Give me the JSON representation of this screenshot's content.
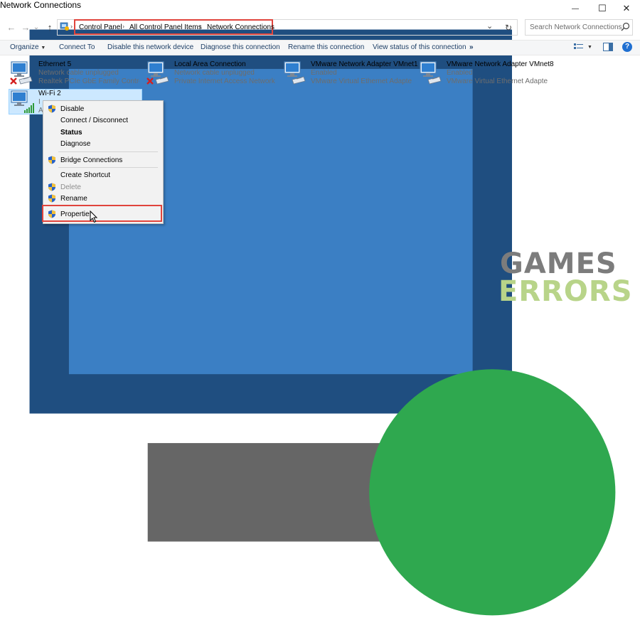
{
  "window": {
    "title": "Network Connections",
    "minimize_glyph": "—",
    "maximize_glyph": "☐",
    "close_glyph": "✕"
  },
  "nav": {
    "back_glyph": "←",
    "forward_glyph": "→",
    "recent_glyph": "⌄",
    "up_glyph": "↑"
  },
  "breadcrumb": {
    "items": [
      "Control Panel",
      "All Control Panel Items",
      "Network Connections"
    ],
    "separator": "›",
    "lead_separator": "›"
  },
  "address": {
    "dropdown_glyph": "⌄",
    "refresh_glyph": "↻"
  },
  "search": {
    "placeholder": "Search Network Connections"
  },
  "commands": {
    "organize": "Organize",
    "organize_arrow": "▼",
    "connect_to": "Connect To",
    "disable_device": "Disable this network device",
    "diagnose": "Diagnose this connection",
    "rename": "Rename this connection",
    "view_status": "View status of this connection",
    "more": "»",
    "view_arrow": "▼",
    "help": "?"
  },
  "adapters": [
    {
      "name": "Ethernet 5",
      "status": "Network cable unplugged",
      "device": "Realtek PCIe GbE Family Controll...",
      "error": true
    },
    {
      "name": "Local Area Connection",
      "status": "Network cable unplugged",
      "device": "Private Internet Access Network A...",
      "error": true
    },
    {
      "name": "VMware Network Adapter VMnet1",
      "status": "Enabled",
      "device": "VMware Virtual Ethernet Adapter ...",
      "error": false
    },
    {
      "name": "VMware Network Adapter VMnet8",
      "status": "Enabled",
      "device": "VMware Virtual Ethernet Adapter ...",
      "error": false
    },
    {
      "name": "Wi-Fi 2",
      "status": "I",
      "device": "A",
      "selected": true
    }
  ],
  "context_menu": {
    "items": [
      {
        "label": "Disable",
        "shield": true
      },
      {
        "label": "Connect / Disconnect",
        "shield": false
      },
      {
        "label": "Status",
        "shield": false,
        "bold": true
      },
      {
        "label": "Diagnose",
        "shield": false
      },
      {
        "label": "Bridge Connections",
        "shield": true
      },
      {
        "label": "Create Shortcut",
        "shield": false
      },
      {
        "label": "Delete",
        "shield": true,
        "disabled": true
      },
      {
        "label": "Rename",
        "shield": true
      },
      {
        "label": "Properties",
        "shield": true,
        "highlighted": true
      }
    ]
  },
  "watermark": {
    "line1": "GAMES",
    "line2": "ERRORS"
  },
  "colors": {
    "accent_red": "#e0443c",
    "selection": "#cce8ff",
    "command_text": "#1e3f66",
    "watermark_gray": "#7c7c7c",
    "watermark_green": "#b8d489"
  }
}
